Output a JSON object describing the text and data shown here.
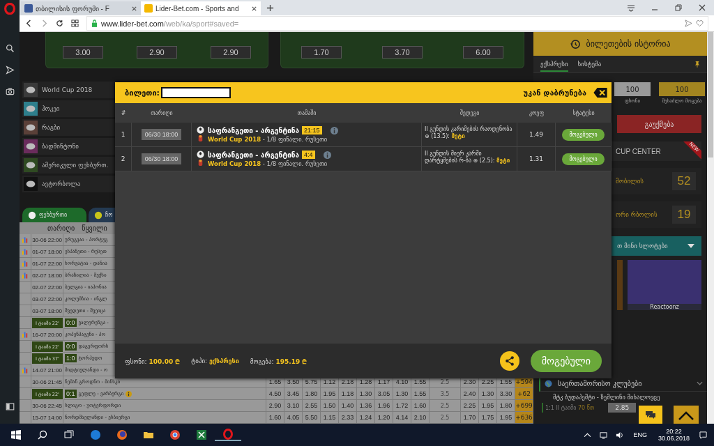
{
  "browser": {
    "tabs": [
      {
        "title": "თბილისის ფორუმი - F",
        "selected": false
      },
      {
        "title": "Lider-Bet.com - Sports and",
        "selected": true
      }
    ],
    "url_host": "www.lider-bet.com",
    "url_path": "/web/ka/sport#saved="
  },
  "match_cards": [
    {
      "odds": [
        "3.00",
        "2.90",
        "2.90"
      ]
    },
    {
      "odds": [
        "1.70",
        "3.70",
        "6.00"
      ]
    }
  ],
  "sports": [
    {
      "label": "World Cup 2018",
      "color": "#3a3a3a"
    },
    {
      "label": "ჰოკეი",
      "color": "#2e7f8c"
    },
    {
      "label": "რაგბი",
      "color": "#5a4038"
    },
    {
      "label": "ბადმინტონი",
      "color": "#6a2c5c"
    },
    {
      "label": "ამერიკული ფეხბურთ.",
      "color": "#2f4a22"
    },
    {
      "label": "ავტორბოლა",
      "color": "#111111"
    }
  ],
  "sport_tabs": [
    {
      "label": "ფეხბურთი",
      "selected": true
    },
    {
      "label": "ჩო",
      "selected": false
    }
  ],
  "table": {
    "columns": [
      "თარიღი",
      "წყვილი"
    ],
    "rows": [
      {
        "kind": "scheduled",
        "stats": true,
        "date": "30-06 22:00",
        "match": "ურუგვაი - პორტუგ"
      },
      {
        "kind": "scheduled",
        "stats": true,
        "date": "01-07 18:00",
        "match": "ესპანეთი - რუსეთ"
      },
      {
        "kind": "scheduled",
        "stats": true,
        "date": "01-07 22:00",
        "match": "ხორვატია - დანია"
      },
      {
        "kind": "scheduled",
        "stats": true,
        "date": "02-07 18:00",
        "match": "ბრაზილია - მექსი"
      },
      {
        "kind": "scheduled",
        "stats": false,
        "date": "02-07 22:00",
        "match": "ბელგია - იაპონია"
      },
      {
        "kind": "scheduled",
        "stats": false,
        "date": "03-07 22:00",
        "match": "კოლუმბია - ინგლ"
      },
      {
        "kind": "scheduled",
        "stats": false,
        "date": "03-07 18:00",
        "match": "შვედეთი - შვეიცა"
      },
      {
        "kind": "live",
        "stats": false,
        "date": "I ტაიმი 22'",
        "score": "0:0",
        "match": "ვალერენგა -"
      },
      {
        "kind": "scheduled",
        "stats": true,
        "date": "16-07 20:00",
        "match": "კოპენჰაგენი - პო"
      },
      {
        "kind": "live",
        "stats": false,
        "date": "I ტაიმი 22'",
        "score": "0:0",
        "match": "დაგერფორს"
      },
      {
        "kind": "live",
        "stats": false,
        "date": "I ტაიმი 37'",
        "score": "1:0",
        "match": "ტორპედო"
      },
      {
        "kind": "scheduled",
        "stats": true,
        "date": "14-07 21:00",
        "match": "მიდტიულანდი - ო"
      },
      {
        "kind": "scheduled",
        "stats": false,
        "date": "30-06 21:45",
        "match": "ნემან გროდნო - მინსკი",
        "odds": [
          "1.65",
          "3.50",
          "5.75",
          "1.12",
          "2.18",
          "1.28",
          "1.17",
          "4.10",
          "1.55"
        ],
        "total": "2.5",
        "odds_total": [
          "2.30",
          "2.25",
          "1.55"
        ],
        "more": "+594"
      },
      {
        "kind": "live",
        "stats": false,
        "date": "I ტაიმი 22'",
        "score": "0:1",
        "match": "გეფლე - ვარბერგი",
        "info": true,
        "odds": [
          "4.50",
          "3.45",
          "1.80",
          "1.95",
          "1.18",
          "1.30",
          "3.05",
          "1.30",
          "1.55"
        ],
        "total": "3.5",
        "odds_total": [
          "2.40",
          "1.30",
          "3.30"
        ],
        "more": "+62"
      },
      {
        "kind": "scheduled",
        "stats": false,
        "date": "30-06 22:45",
        "match": "სლიგო - უოტერფორდი",
        "odds": [
          "2.90",
          "3.10",
          "2.55",
          "1.50",
          "1.40",
          "1.36",
          "1.96",
          "1.72",
          "1.60"
        ],
        "total": "2.5",
        "odds_total": [
          "2.25",
          "1.95",
          "1.80"
        ],
        "more": "+699"
      },
      {
        "kind": "scheduled",
        "stats": false,
        "date": "15-07 14:00",
        "match": "ნორდშაელანდი - ესბიერგი",
        "odds": [
          "1.60",
          "4.05",
          "5.50",
          "1.15",
          "2.33",
          "1.24",
          "1.20",
          "4.14",
          "2.10"
        ],
        "total": "2.5",
        "odds_total": [
          "1.70",
          "1.75",
          "1.95"
        ],
        "more": "+636"
      }
    ]
  },
  "modal": {
    "title": "ბილეთი:",
    "back": "უკან დაბრუნება",
    "columns": [
      "#",
      "თარიღი",
      "თამაში",
      "შედეგი",
      "კოეფ",
      "სტატუსი"
    ],
    "rows": [
      {
        "index": "1",
        "date": "06/30 18:00",
        "match": "საფრანგეთი - არგენტინა",
        "score": "21:15",
        "league": "World Cup 2018",
        "stage": " - 1/8 ფინალი. რუსეთი",
        "outcome": "II გუნდის კარიმების რაოდენობა ⊕ (13.5): ",
        "pick": "მეტი",
        "odds": "1.49",
        "status": "მოგებული",
        "color": "#6aa83a"
      },
      {
        "index": "2",
        "date": "06/30 18:00",
        "match": "საფრანგეთი - არგენტინა",
        "score": "4:4",
        "league": "World Cup 2018",
        "stage": " - 1/8 ფინალი. რუსეთი",
        "outcome": "II გუნდის მიერ კარში დარტყმების რ-ბა ⊕ (2.5): ",
        "pick": "მეტი",
        "odds": "1.31",
        "status": "მოგებული",
        "color": "#6aa83a"
      }
    ],
    "summary": [
      {
        "label": "ფსონი:",
        "value": "100.00 ₾"
      },
      {
        "label": "ტიპი:",
        "value": "ექსპრესი"
      },
      {
        "label": "მოგება:",
        "value": "195.19 ₾"
      }
    ],
    "status": {
      "label": "მოგებული",
      "color": "#6aa83a"
    }
  },
  "right_panel": {
    "history_button": "ბილეთების ისტორია",
    "bet_tabs": [
      {
        "label": "ექსპრესი",
        "selected": true
      },
      {
        "label": "სისტემა",
        "selected": false
      }
    ],
    "stake": {
      "value": "100",
      "label": "ფსონი"
    },
    "possible_win": {
      "value": "100",
      "label": "შესაძლო მოგება"
    },
    "cancel_button": "გაუქმება",
    "cup_center": {
      "title": "CUP CENTER",
      "ribbon": "NEW"
    },
    "promos": [
      {
        "title": "მობილის",
        "count": "52"
      },
      {
        "title": "ორი რბოლის",
        "count": "19"
      }
    ],
    "slots": {
      "title": "თ მინი სლოტები",
      "game": "Reactoonz"
    },
    "live": {
      "category": "საერთაშორისო კლუბები",
      "match": "მტკ ბუდაპეშტი - ზემლინი მიხალოვცე",
      "score": "1:1",
      "period": "II ტაიმი",
      "minute": "70 წთ",
      "odds": "2.85"
    }
  },
  "taskbar": {
    "language": "ENG",
    "time": "20:22",
    "date": "30.06.2018"
  }
}
